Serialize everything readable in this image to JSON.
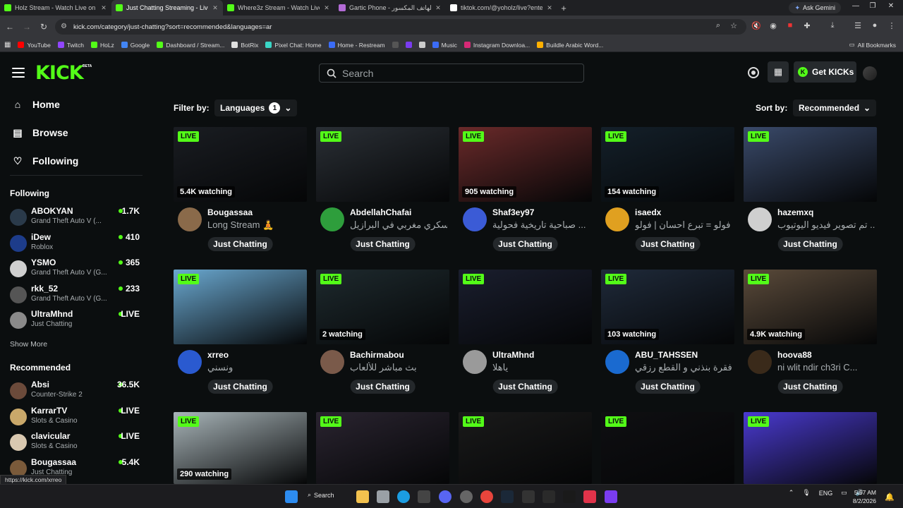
{
  "browser": {
    "tabs": [
      {
        "title": "Holz Stream - Watch Live on Ki",
        "icon": "kick-favicon",
        "color": "#53fc18",
        "active": false
      },
      {
        "title": "Just Chatting Streaming - Live S",
        "icon": "kick-favicon",
        "color": "#53fc18",
        "active": true
      },
      {
        "title": "Where3z Stream - Watch Live o",
        "icon": "kick-favicon",
        "color": "#53fc18",
        "active": false
      },
      {
        "title": "Gartic Phone - الهاتف المكسور",
        "icon": "gartic-favicon",
        "color": "#b36bd6",
        "active": false
      },
      {
        "title": "tiktok.com/@yoholz/live?enter",
        "icon": "tiktok-favicon",
        "color": "#ffffff",
        "active": false
      }
    ],
    "ask_gemini": "Ask Gemini",
    "url": "kick.com/category/just-chatting?sort=recommended&languages=ar",
    "bookmarks": [
      {
        "label": "YouTube",
        "color": "#ff0000"
      },
      {
        "label": "Twitch",
        "color": "#9146ff"
      },
      {
        "label": "HoLz",
        "color": "#53fc18"
      },
      {
        "label": "Google",
        "color": "#4285f4"
      },
      {
        "label": "Dashboard / Stream...",
        "color": "#53fc18"
      },
      {
        "label": "BotRix",
        "color": "#e0e0e0"
      },
      {
        "label": "Pixel Chat: Home",
        "color": "#3ad6c6"
      },
      {
        "label": "Home - Restream",
        "color": "#3b6cf6"
      },
      {
        "label": "",
        "color": "#555555"
      },
      {
        "label": "",
        "color": "#7a3cf0"
      },
      {
        "label": "",
        "color": "#cccccc"
      },
      {
        "label": "Music",
        "color": "#3b6cf6"
      },
      {
        "label": "Instagram Downloa...",
        "color": "#d62976"
      },
      {
        "label": "Buildle Arabic Word...",
        "color": "#ffb000"
      }
    ],
    "all_bookmarks": "All Bookmarks",
    "status_url": "https://kick.com/xrreo"
  },
  "header": {
    "logo": "KICK",
    "logo_badge": "BETA",
    "search_placeholder": "Search",
    "get_kicks": "Get KICKs",
    "kicks_icon_letter": "K",
    "accent": "#53fc18"
  },
  "sidebar": {
    "nav": [
      {
        "label": "Home",
        "icon": "home-icon"
      },
      {
        "label": "Browse",
        "icon": "browse-icon"
      },
      {
        "label": "Following",
        "icon": "heart-icon"
      }
    ],
    "following_heading": "Following",
    "following": [
      {
        "name": "ABOKYAN",
        "category": "Grand Theft Auto V (...",
        "viewers": "1.7K",
        "avatar_color": "#2a3a4a"
      },
      {
        "name": "iDew",
        "category": "Roblox",
        "viewers": "410",
        "avatar_color": "#1d3c8a"
      },
      {
        "name": "YSMO",
        "category": "Grand Theft Auto V (G...",
        "viewers": "365",
        "avatar_color": "#cfcfcf"
      },
      {
        "name": "rkk_52",
        "category": "Grand Theft Auto V (G...",
        "viewers": "233",
        "avatar_color": "#555555"
      },
      {
        "name": "UltraMhnd",
        "category": "Just Chatting",
        "viewers": "LIVE",
        "avatar_color": "#8a8a8a"
      }
    ],
    "show_more": "Show More",
    "recommended_heading": "Recommended",
    "recommended": [
      {
        "name": "Absi",
        "category": "Counter-Strike 2",
        "viewers": "36.5K",
        "avatar_color": "#6b4a3a"
      },
      {
        "name": "KarrarTV",
        "category": "Slots & Casino",
        "viewers": "LIVE",
        "avatar_color": "#c9a86a"
      },
      {
        "name": "clavicular",
        "category": "Slots & Casino",
        "viewers": "LIVE",
        "avatar_color": "#d9c8b0"
      },
      {
        "name": "Bougassaa",
        "category": "Just Chatting",
        "viewers": "5.4K",
        "avatar_color": "#7a5a3a"
      }
    ]
  },
  "main": {
    "filter_label": "Filter by:",
    "language_button": "Languages",
    "language_count": "1",
    "sort_label": "Sort by:",
    "sort_value": "Recommended",
    "live_label": "LIVE",
    "streams": [
      {
        "name": "Bougassaa",
        "title": "Long Stream 🧘",
        "category": "Just Chatting",
        "watching": "5.4K watching",
        "thumb_color": "#1a1d22",
        "avatar_color": "#8a6a4a"
      },
      {
        "name": "AbdellahChafai",
        "title": "عسكري مغربي في البرازيل",
        "category": "Just Chatting",
        "watching": "",
        "thumb_color": "#2a2f35",
        "avatar_color": "#2e9e3c"
      },
      {
        "name": "Shaf3ey97",
        "title": "صباحية تاريخية فحولية ...",
        "category": "Just Chatting",
        "watching": "905 watching",
        "thumb_color": "#6a2a2a",
        "avatar_color": "#3b5bd6"
      },
      {
        "name": "isaedx",
        "title": "فولو = تبرع احسان | فولو ...",
        "category": "Just Chatting",
        "watching": "154 watching",
        "thumb_color": "#14202a",
        "avatar_color": "#e0a020"
      },
      {
        "name": "hazemxq",
        "title": "تم تصوير فيديو اليوتيوب ...",
        "category": "Just Chatting",
        "watching": "",
        "thumb_color": "#3a4a6a",
        "avatar_color": "#cfcfcf"
      },
      {
        "name": "xrreo",
        "title": "ونسني",
        "category": "Just Chatting",
        "watching": "",
        "thumb_color": "#6aa8d0",
        "avatar_color": "#2a5ad0"
      },
      {
        "name": "Bachirmabou",
        "title": "بث مباشر للألعاب",
        "category": "Just Chatting",
        "watching": "2 watching",
        "thumb_color": "#1e2a2e",
        "avatar_color": "#7a5a4a"
      },
      {
        "name": "UltraMhnd",
        "title": "ياهلا",
        "category": "Just Chatting",
        "watching": "",
        "thumb_color": "#1a1e2e",
        "avatar_color": "#9a9a9a"
      },
      {
        "name": "ABU_TAHSSEN",
        "title": "فقرة بنذني و القطع رزقي",
        "category": "Just Chatting",
        "watching": "103 watching",
        "thumb_color": "#1f2a3a",
        "avatar_color": "#1a6ad0"
      },
      {
        "name": "hoova88",
        "title": "ni wlit ndir ch3ri C...",
        "category": "Just Chatting",
        "watching": "4.9K watching",
        "thumb_color": "#5a4a3a",
        "avatar_color": "#3a2a1a"
      },
      {
        "name": "",
        "title": "",
        "category": "",
        "watching": "290 watching",
        "thumb_color": "#a8b4b8",
        "avatar_color": ""
      },
      {
        "name": "",
        "title": "",
        "category": "",
        "watching": "",
        "thumb_color": "#2a2430",
        "avatar_color": ""
      },
      {
        "name": "",
        "title": "",
        "category": "",
        "watching": "",
        "thumb_color": "#1a1a1a",
        "avatar_color": ""
      },
      {
        "name": "",
        "title": "",
        "category": "",
        "watching": "",
        "thumb_color": "#0f0f12",
        "avatar_color": ""
      },
      {
        "name": "",
        "title": "",
        "category": "",
        "watching": "",
        "thumb_color": "#4a3ad0",
        "avatar_color": ""
      }
    ]
  },
  "taskbar": {
    "search_label": "Search",
    "lang": "ENG",
    "time": "5:57 AM",
    "date": "8/2/2026"
  }
}
